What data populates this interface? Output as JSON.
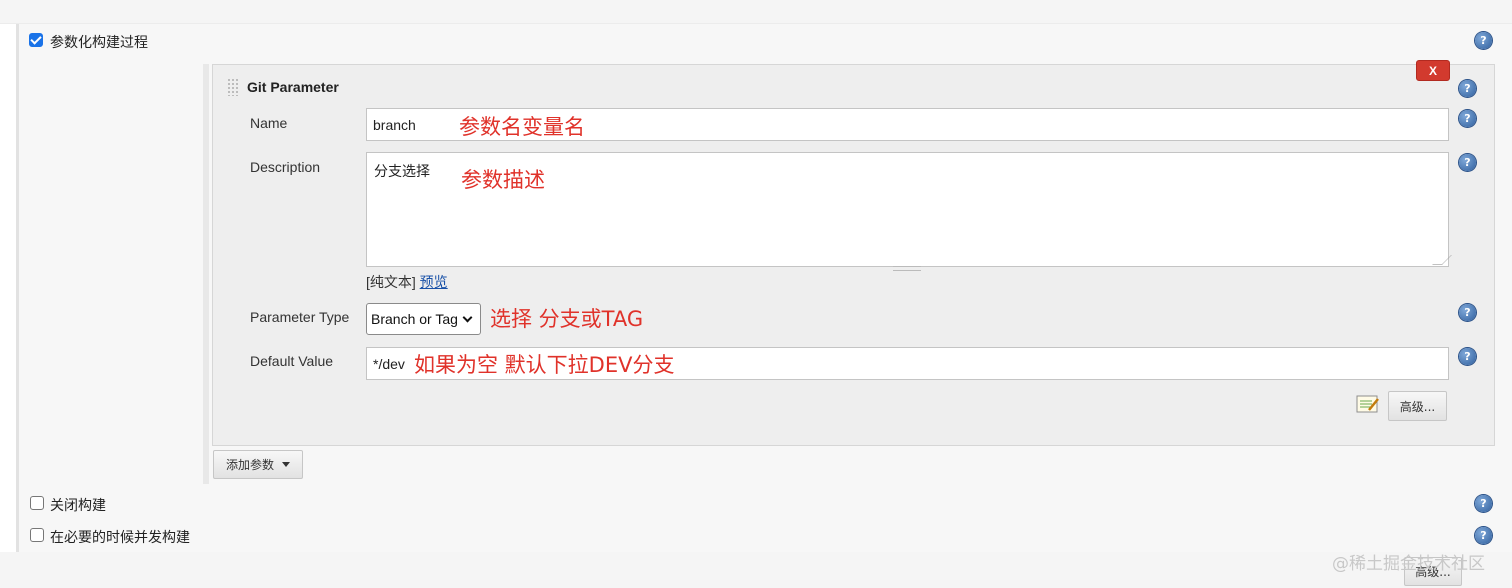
{
  "options": {
    "parameterized": {
      "label": "参数化构建过程",
      "checked": true
    },
    "disable_build": {
      "label": "关闭构建",
      "checked": false
    },
    "concurrent": {
      "label": "在必要的时候并发构建",
      "checked": false
    }
  },
  "parameter": {
    "title": "Git Parameter",
    "delete_label": "X",
    "name": {
      "label": "Name",
      "value": "branch",
      "annotation": "参数名变量名"
    },
    "description": {
      "label": "Description",
      "value": "分支选择",
      "annotation": "参数描述",
      "format_prefix": "[纯文本]",
      "preview_link": "预览"
    },
    "param_type": {
      "label": "Parameter Type",
      "selected": "Branch or Tag",
      "annotation": "选择 分支或TAG"
    },
    "default_value": {
      "label": "Default Value",
      "value": "*/dev",
      "annotation": "如果为空 默认下拉DEV分支"
    },
    "advanced_label": "高级..."
  },
  "add_param_label": "添加参数",
  "bottom_advanced_label": "高级...",
  "help_glyph": "?",
  "watermark": "@稀土掘金技术社区",
  "colors": {
    "annotation": "#e0322a",
    "delete": "#d23a2e",
    "checkbox": "#1a73e8",
    "link": "#1a52a8"
  }
}
